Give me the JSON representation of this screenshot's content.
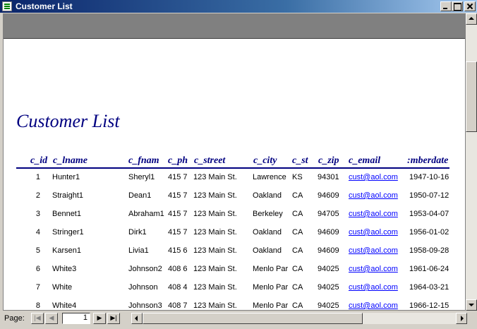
{
  "window": {
    "title": "Customer List"
  },
  "report": {
    "title": "Customer List",
    "columns": [
      {
        "key": "c_id",
        "label": "c_id"
      },
      {
        "key": "c_lname",
        "label": "c_lname"
      },
      {
        "key": "c_fname",
        "label": "c_fnam"
      },
      {
        "key": "c_phone",
        "label": "c_ph"
      },
      {
        "key": "c_street",
        "label": "c_street"
      },
      {
        "key": "c_city",
        "label": "c_city"
      },
      {
        "key": "c_st",
        "label": "c_st"
      },
      {
        "key": "c_zip",
        "label": "c_zip"
      },
      {
        "key": "c_email",
        "label": "c_email"
      },
      {
        "key": "memberdate",
        "label": ":mberdate"
      }
    ],
    "rows": [
      {
        "c_id": "1",
        "c_lname": "Hunter1",
        "c_fname": "Sheryl1",
        "c_phone": "415 7",
        "c_street": "123 Main St.",
        "c_city": "Lawrence",
        "c_st": "KS",
        "c_zip": "94301",
        "c_email": "cust@aol.com",
        "memberdate": "1947-10-16"
      },
      {
        "c_id": "2",
        "c_lname": "Straight1",
        "c_fname": "Dean1",
        "c_phone": "415 7",
        "c_street": "123 Main St.",
        "c_city": "Oakland",
        "c_st": "CA",
        "c_zip": "94609",
        "c_email": "cust@aol.com",
        "memberdate": "1950-07-12"
      },
      {
        "c_id": "3",
        "c_lname": "Bennet1",
        "c_fname": "Abraham1",
        "c_phone": "415 7",
        "c_street": "123 Main St.",
        "c_city": "Berkeley",
        "c_st": "CA",
        "c_zip": "94705",
        "c_email": "cust@aol.com",
        "memberdate": "1953-04-07"
      },
      {
        "c_id": "4",
        "c_lname": "Stringer1",
        "c_fname": "Dirk1",
        "c_phone": "415 7",
        "c_street": "123 Main St.",
        "c_city": "Oakland",
        "c_st": "CA",
        "c_zip": "94609",
        "c_email": "cust@aol.com",
        "memberdate": "1956-01-02"
      },
      {
        "c_id": "5",
        "c_lname": "Karsen1",
        "c_fname": "Livia1",
        "c_phone": "415 6",
        "c_street": "123 Main St.",
        "c_city": "Oakland",
        "c_st": "CA",
        "c_zip": "94609",
        "c_email": "cust@aol.com",
        "memberdate": "1958-09-28"
      },
      {
        "c_id": "6",
        "c_lname": "White3",
        "c_fname": "Johnson2",
        "c_phone": "408 6",
        "c_street": "123 Main St.",
        "c_city": "Menlo Par",
        "c_st": "CA",
        "c_zip": "94025",
        "c_email": "cust@aol.com",
        "memberdate": "1961-06-24"
      },
      {
        "c_id": "7",
        "c_lname": "White",
        "c_fname": "Johnson",
        "c_phone": "408 4",
        "c_street": "123 Main St.",
        "c_city": "Menlo Par",
        "c_st": "CA",
        "c_zip": "94025",
        "c_email": "cust@aol.com",
        "memberdate": "1964-03-21"
      },
      {
        "c_id": "8",
        "c_lname": "White4",
        "c_fname": "Johnson3",
        "c_phone": "408 7",
        "c_street": "123 Main St.",
        "c_city": "Menlo Par",
        "c_st": "CA",
        "c_zip": "94025",
        "c_email": "cust@aol.com",
        "memberdate": "1966-12-15"
      }
    ]
  },
  "navigation": {
    "page_label": "Page:",
    "current_page": "1",
    "first_icon": "first-record-icon",
    "prev_icon": "previous-record-icon",
    "next_icon": "next-record-icon",
    "last_icon": "last-record-icon"
  },
  "colors": {
    "title_blue": "#000080",
    "link_blue": "#0000ff",
    "header_band": "#808080"
  }
}
